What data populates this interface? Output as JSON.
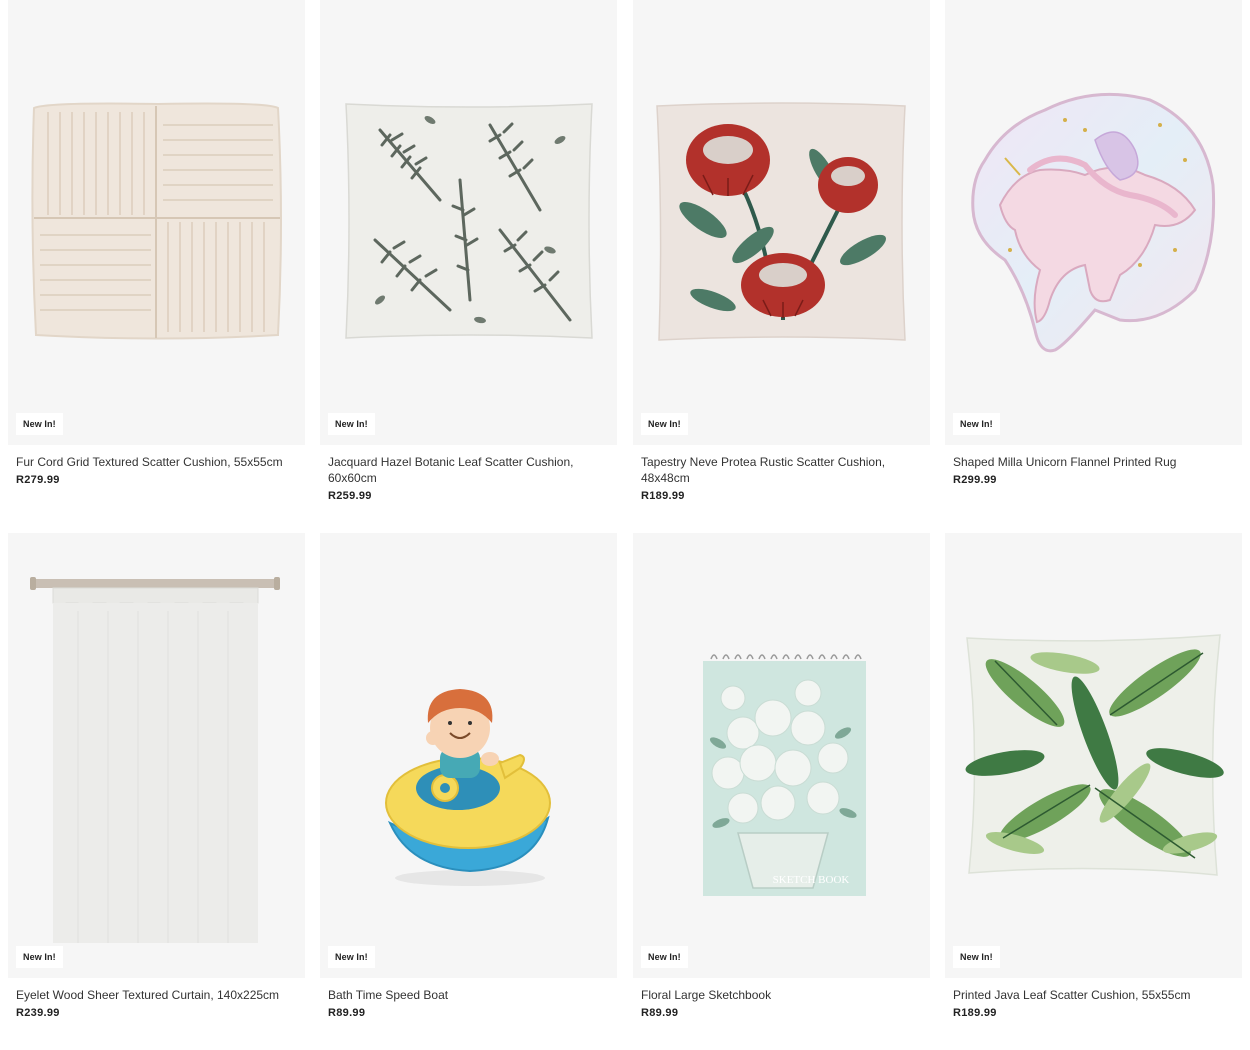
{
  "products": [
    {
      "name": "Fur Cord Grid Textured Scatter Cushion, 55x55cm",
      "price": "R279.99",
      "badge": "New In!",
      "image": "cream-corduroy-cushion"
    },
    {
      "name": "Jacquard Hazel Botanic Leaf Scatter Cushion, 60x60cm",
      "price": "R259.99",
      "badge": "New In!",
      "image": "grey-leaf-print-cushion"
    },
    {
      "name": "Tapestry Neve Protea Rustic Scatter Cushion, 48x48cm",
      "price": "R189.99",
      "badge": "New In!",
      "image": "red-protea-cushion"
    },
    {
      "name": "Shaped Milla Unicorn Flannel Printed Rug",
      "price": "R299.99",
      "badge": "New In!",
      "image": "unicorn-rug"
    },
    {
      "name": "Eyelet Wood Sheer Textured Curtain, 140x225cm",
      "price": "R239.99",
      "badge": "New In!",
      "image": "sheer-curtain-on-rod"
    },
    {
      "name": "Bath Time Speed Boat",
      "price": "R89.99",
      "badge": "New In!",
      "image": "toy-speed-boat"
    },
    {
      "name": "Floral Large Sketchbook",
      "price": "R89.99",
      "badge": "New In!",
      "image": "floral-sketchbook",
      "cover_text": "SKETCH BOOK"
    },
    {
      "name": "Printed Java Leaf Scatter Cushion, 55x55cm",
      "price": "R189.99",
      "badge": "New In!",
      "image": "green-leaf-cushion"
    }
  ],
  "colors": {
    "image_bg": "#f6f6f6",
    "text": "#333333",
    "price": "#222222"
  }
}
